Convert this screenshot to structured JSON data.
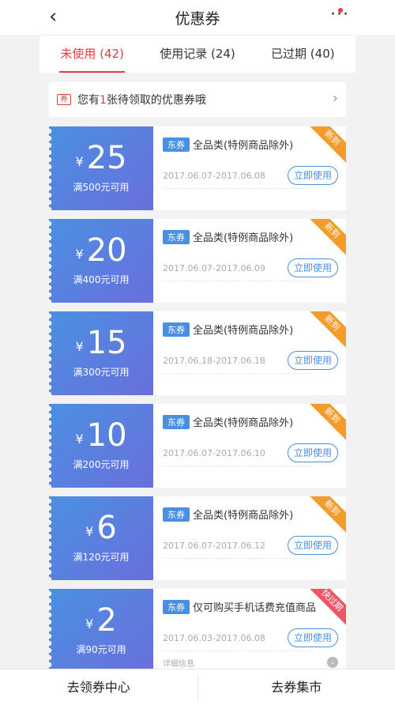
{
  "header": {
    "title": "优惠券",
    "more_label": "···"
  },
  "tabs": [
    {
      "label": "未使用 (42)",
      "active": true
    },
    {
      "label": "使用记录 (24)",
      "active": false
    },
    {
      "label": "已过期 (40)",
      "active": false
    }
  ],
  "notice": {
    "prefix": "您有",
    "count": "1",
    "suffix": "张待领取的优惠券哦",
    "icon_label": "券"
  },
  "coupons": [
    {
      "currency": "¥",
      "amount": "25",
      "condition": "满500元可用",
      "tag": "东券",
      "desc": "全品类(特例商品除外)",
      "date": "2017.06.07-2017.06.08",
      "button": "立即使用",
      "corner": "新到"
    },
    {
      "currency": "¥",
      "amount": "20",
      "condition": "满400元可用",
      "tag": "东券",
      "desc": "全品类(特例商品除外)",
      "date": "2017.06.07-2017.06.09",
      "button": "立即使用",
      "corner": "新到"
    },
    {
      "currency": "¥",
      "amount": "15",
      "condition": "满300元可用",
      "tag": "东券",
      "desc": "全品类(特例商品除外)",
      "date": "2017.06.18-2017.06.18",
      "button": "立即使用",
      "corner": "新到"
    },
    {
      "currency": "¥",
      "amount": "10",
      "condition": "满200元可用",
      "tag": "东券",
      "desc": "全品类(特例商品除外)",
      "date": "2017.06.07-2017.06.10",
      "button": "立即使用",
      "corner": "新到"
    },
    {
      "currency": "¥",
      "amount": "6",
      "condition": "满120元可用",
      "tag": "东券",
      "desc": "全品类(特例商品除外)",
      "date": "2017.06.07-2017.06.12",
      "button": "立即使用",
      "corner": "新到"
    },
    {
      "currency": "¥",
      "amount": "2",
      "condition": "满90元可用",
      "tag": "东券",
      "desc": "仅可购买手机话费充值商品",
      "date": "2017.06.03-2017.06.08",
      "button": "立即使用",
      "corner": "快过期",
      "detail": "详细信息"
    }
  ],
  "bottom": {
    "left": "去领券中心",
    "right": "去券集市"
  },
  "colors": {
    "accent": "#e93b3d",
    "coupon_blue": "#4a90e2",
    "corner_orange": "#f39c2c",
    "corner_red": "#ee5566"
  }
}
